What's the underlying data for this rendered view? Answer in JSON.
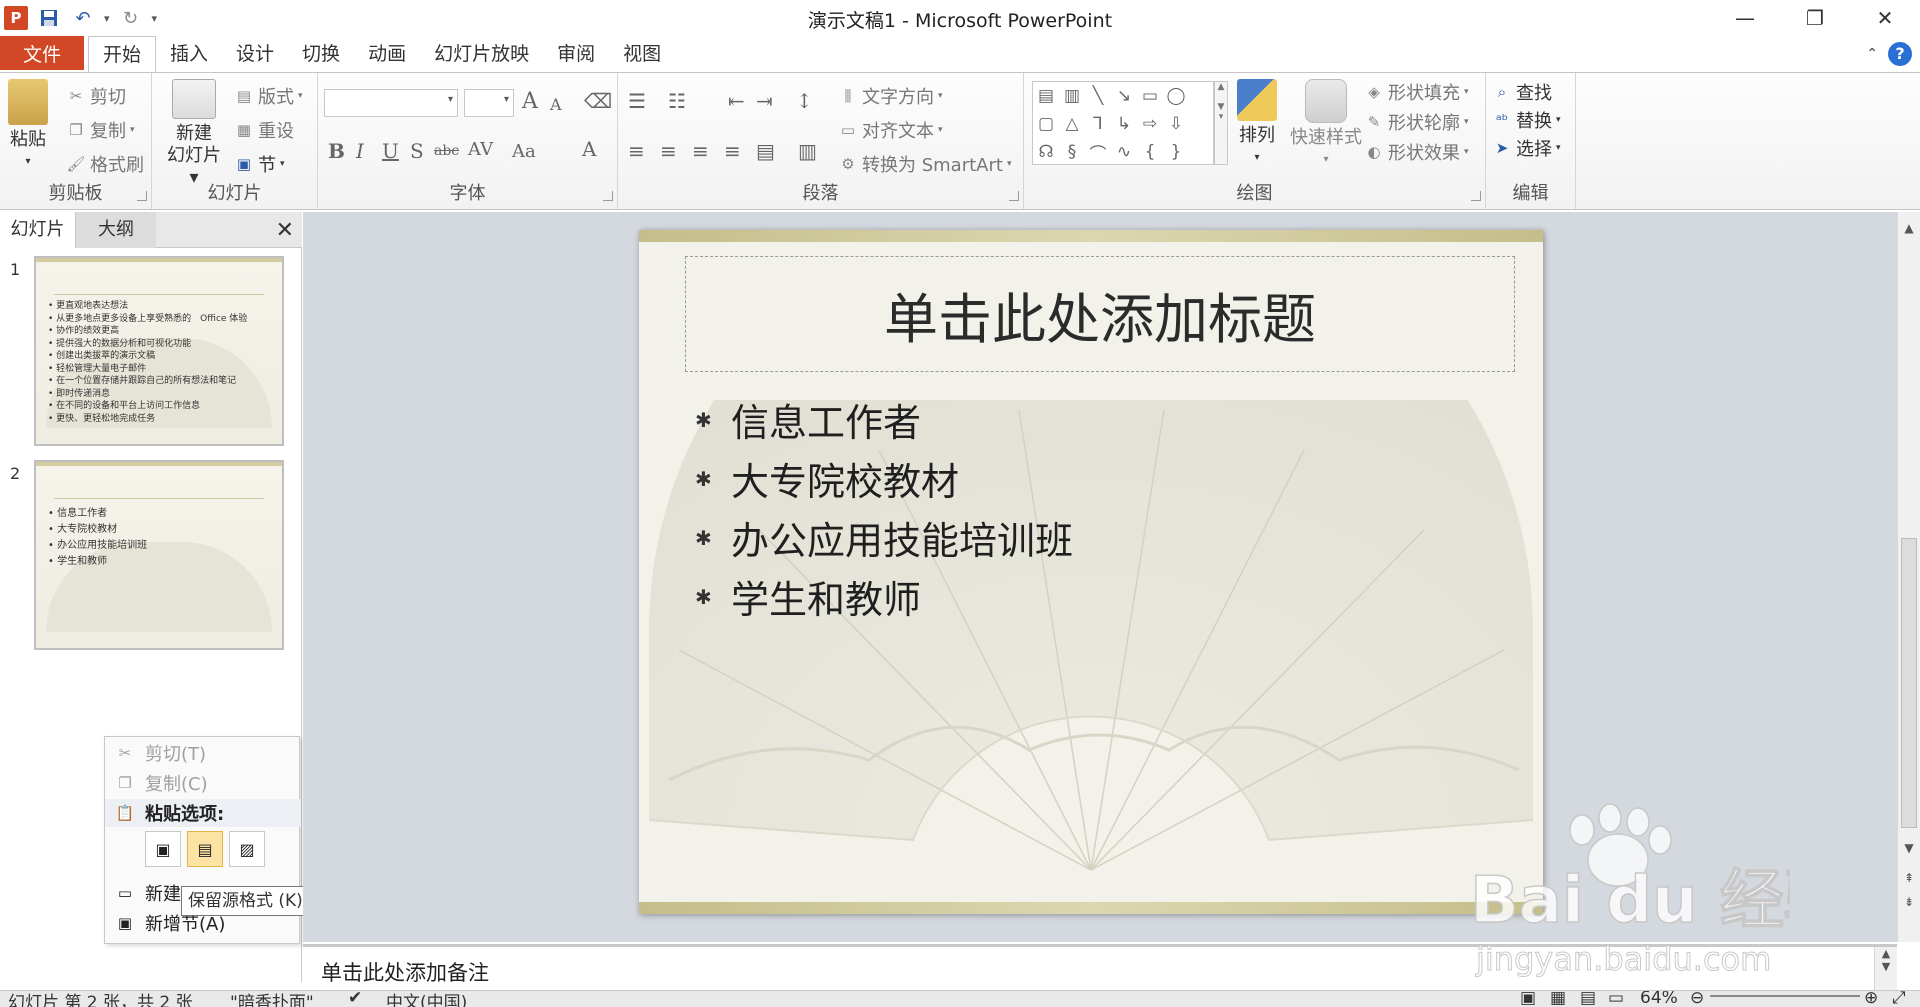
{
  "window": {
    "title": "演示文稿1 - Microsoft PowerPoint",
    "app_icon": "P"
  },
  "quick_access": {
    "save": "save-icon",
    "undo": "undo-icon",
    "redo": "redo-icon",
    "customize": "▾"
  },
  "tabs": {
    "file": "文件",
    "items": [
      "开始",
      "插入",
      "设计",
      "切换",
      "动画",
      "幻灯片放映",
      "审阅",
      "视图"
    ]
  },
  "ribbon": {
    "clipboard": {
      "paste": "粘贴",
      "cut": "剪切",
      "copy": "复制",
      "format_painter": "格式刷",
      "label": "剪贴板"
    },
    "slides": {
      "new_slide_line1": "新建",
      "new_slide_line2": "幻灯片",
      "layout": "版式",
      "reset": "重设",
      "section": "节",
      "label": "幻灯片"
    },
    "font": {
      "label": "字体",
      "bold": "B",
      "italic": "I",
      "underline": "U",
      "shadow": "S",
      "strike": "abc",
      "spacing": "AV",
      "case": "Aa",
      "color": "A",
      "grow": "A",
      "shrink": "A"
    },
    "paragraph": {
      "label": "段落",
      "text_direction": "文字方向",
      "align_text": "对齐文本",
      "smartart": "转换为 SmartArt"
    },
    "drawing": {
      "label": "绘图",
      "arrange": "排列",
      "quick_styles": "快速样式",
      "shape_fill": "形状填充",
      "shape_outline": "形状轮廓",
      "shape_effects": "形状效果"
    },
    "editing": {
      "label": "编辑",
      "find": "查找",
      "replace": "替换",
      "select": "选择"
    }
  },
  "left_panel": {
    "tab_slides": "幻灯片",
    "tab_outline": "大纲",
    "thumbnails": [
      {
        "number": "1",
        "bullets": [
          "更直观地表达想法",
          "从更多地点更多设备上享受熟悉的　Office 体验",
          "协作的绩效更高",
          "提供强大的数据分析和可视化功能",
          "创建出类拔萃的演示文稿",
          "轻松管理大量电子邮件",
          "在一个位置存储并跟踪自己的所有想法和笔记",
          "即时传递消息",
          "在不同的设备和平台上访问工作信息",
          "更快、更轻松地完成任务"
        ]
      },
      {
        "number": "2",
        "bullets": [
          "信息工作者",
          "大专院校教材",
          "办公应用技能培训班",
          "学生和教师"
        ]
      }
    ]
  },
  "context_menu": {
    "cut": "剪切(T)",
    "copy": "复制(C)",
    "paste_options": "粘贴选项:",
    "new_slide": "新建",
    "add_section": "新增节(A)",
    "tooltip": "保留源格式 (K)"
  },
  "slide": {
    "title": "单击此处添加标题",
    "bullets": [
      "信息工作者",
      "大专院校教材",
      "办公应用技能培训班",
      "学生和教师"
    ]
  },
  "notes": {
    "placeholder": "单击此处添加备注"
  },
  "status": {
    "slide_info": "幻灯片 第 2 张，共 2 张",
    "theme": "\"暗香扑面\"",
    "language": "中文(中国)",
    "zoom": "64%"
  },
  "watermark": {
    "brand": "Bai du 经验",
    "url": "jingyan.baidu.com"
  }
}
